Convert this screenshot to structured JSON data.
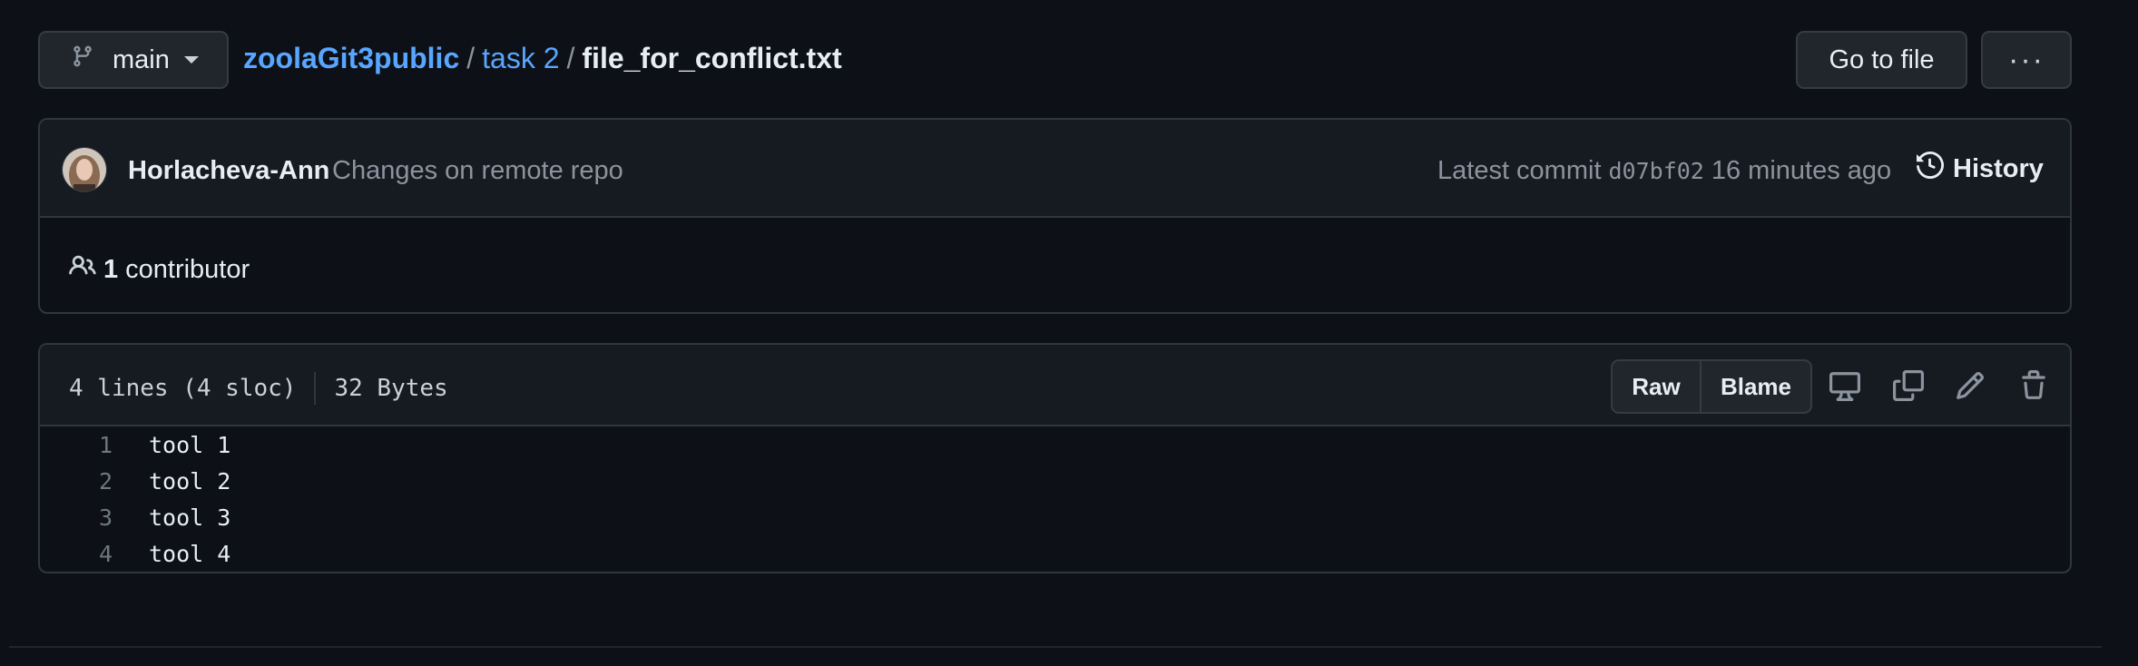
{
  "branch": {
    "label": "main",
    "icon": "git-branch-icon"
  },
  "breadcrumb": {
    "repo": "zoolaGit3public",
    "sep1": "/",
    "folder": "task 2",
    "sep2": "/",
    "file": "file_for_conflict.txt"
  },
  "actions": {
    "goto_label": "Go to file",
    "more_icon": "kebab-horizontal-icon",
    "more_label": "···"
  },
  "commit": {
    "author": "Horlacheva-Ann",
    "message": "Changes on remote repo",
    "latest_label": "Latest commit",
    "sha": "d07bf02",
    "time": "16 minutes ago",
    "history_label": "History"
  },
  "contributors": {
    "count": "1",
    "label": "contributor"
  },
  "file": {
    "lines_info": "4 lines (4 sloc)",
    "size": "32 Bytes",
    "raw_label": "Raw",
    "blame_label": "Blame",
    "lines": [
      {
        "num": "1",
        "text": "tool 1"
      },
      {
        "num": "2",
        "text": "tool 2"
      },
      {
        "num": "3",
        "text": "tool 3"
      },
      {
        "num": "4",
        "text": "tool 4"
      }
    ]
  },
  "colors": {
    "background": "#0d1117",
    "link": "#58a6ff",
    "border": "#30363d",
    "muted": "#8b949e"
  }
}
